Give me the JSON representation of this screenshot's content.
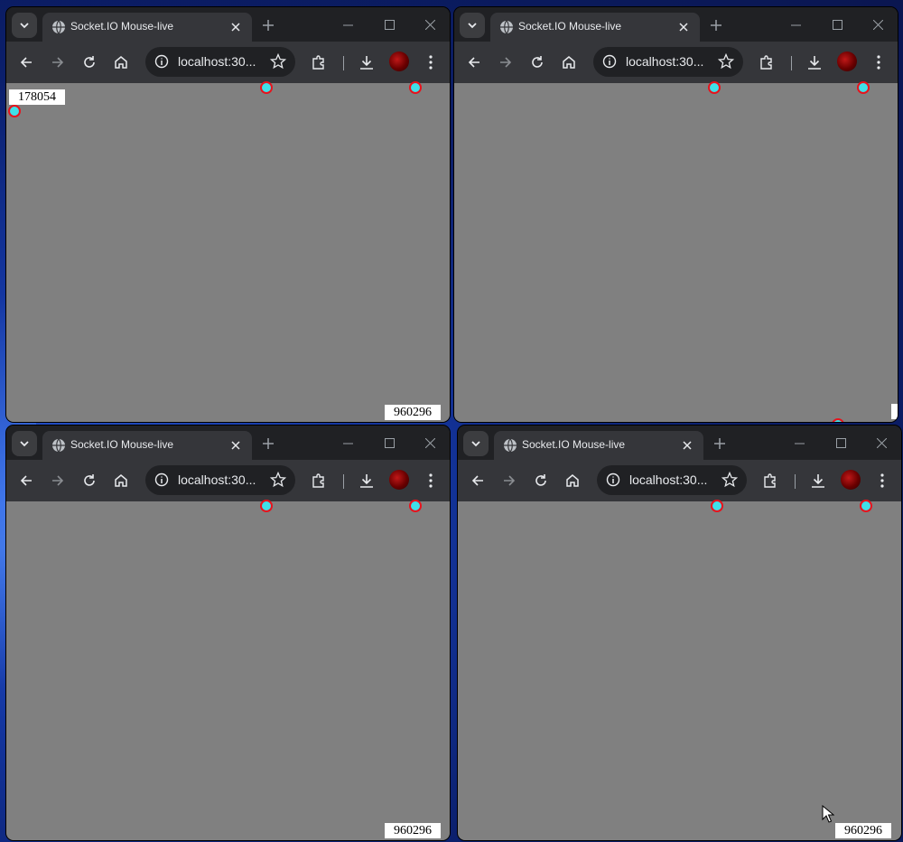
{
  "windows": [
    {
      "tab_title": "Socket.IO Mouse-live",
      "url": "localhost:30...",
      "counter_top": "178054",
      "counter_bottom": "960296"
    },
    {
      "tab_title": "Socket.IO Mouse-live",
      "url": "localhost:30..."
    },
    {
      "tab_title": "Socket.IO Mouse-live",
      "url": "localhost:30...",
      "counter_bottom": "960296"
    },
    {
      "tab_title": "Socket.IO Mouse-live",
      "url": "localhost:30...",
      "counter_bottom": "960296"
    }
  ],
  "colors": {
    "canvas_bg": "#808080",
    "dot_fill": "#3fe0e8",
    "dot_border": "#e8121c",
    "chrome_dark": "#202124",
    "chrome_toolbar": "#35363a"
  },
  "icons": [
    "tab-search-icon",
    "globe-icon",
    "close-icon",
    "plus-icon",
    "minimize-icon",
    "maximize-icon",
    "back-icon",
    "forward-icon",
    "reload-icon",
    "home-icon",
    "info-icon",
    "star-icon",
    "extensions-icon",
    "download-icon",
    "profile-avatar",
    "kebab-menu-icon",
    "mouse-cursor-icon"
  ]
}
